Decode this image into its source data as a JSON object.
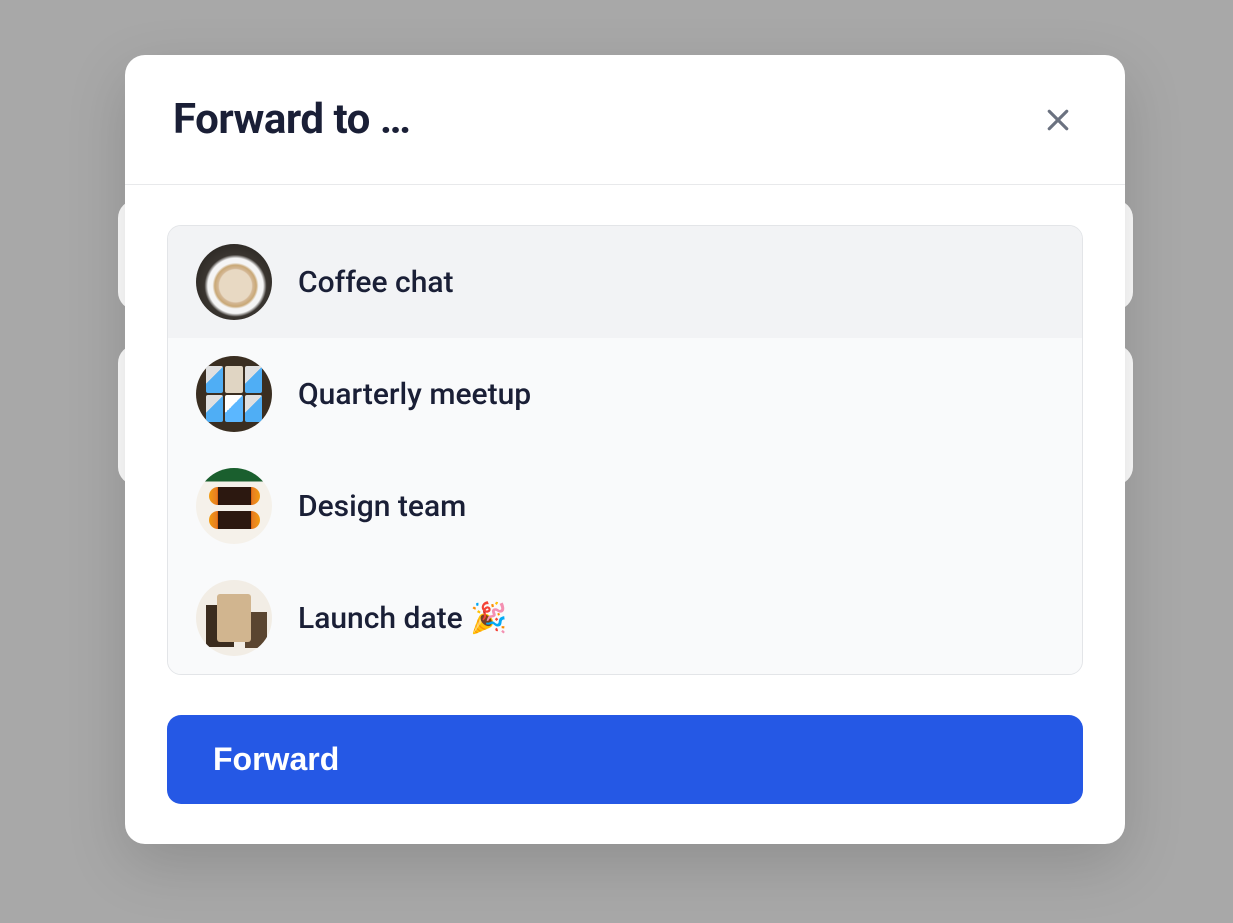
{
  "modal": {
    "title": "Forward to …",
    "close_icon": "close"
  },
  "rooms": [
    {
      "name": "Coffee chat",
      "avatar": "coffee",
      "selected": true
    },
    {
      "name": "Quarterly meetup",
      "avatar": "meetup",
      "selected": false
    },
    {
      "name": "Design team",
      "avatar": "design",
      "selected": false
    },
    {
      "name": "Launch date 🎉",
      "avatar": "launch",
      "selected": false
    }
  ],
  "actions": {
    "forward_label": "Forward"
  }
}
